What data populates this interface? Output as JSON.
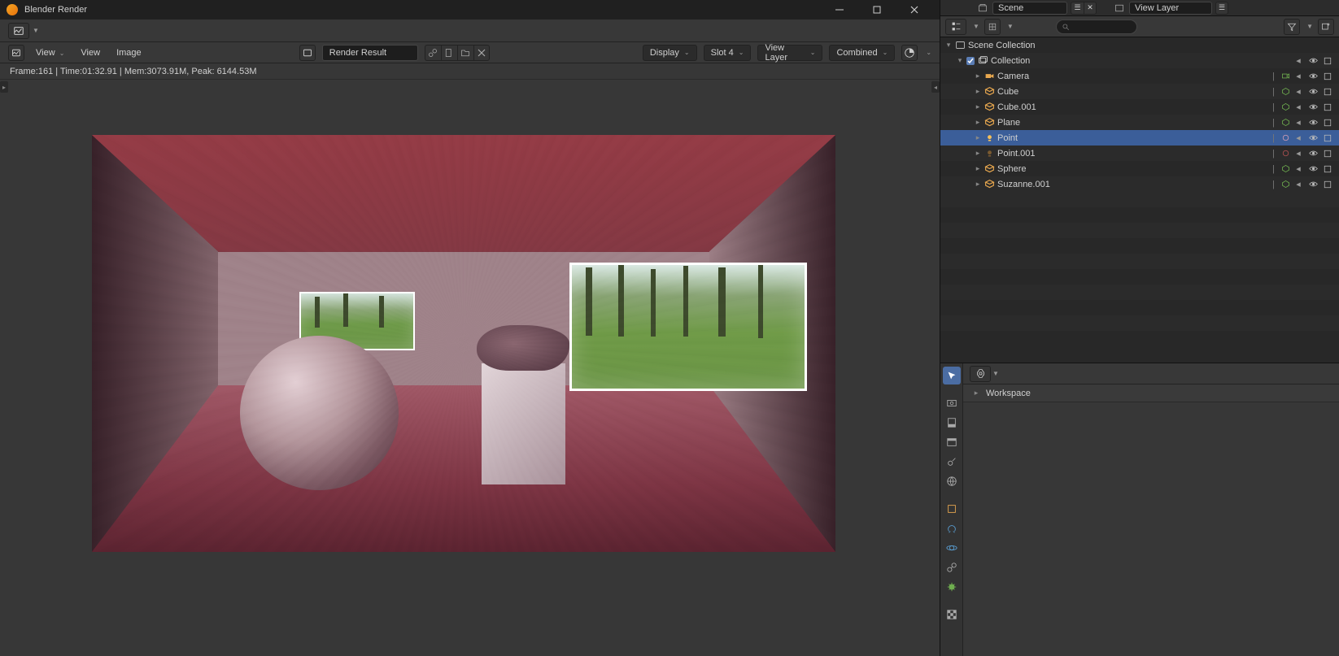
{
  "window": {
    "title": "Blender Render"
  },
  "toolbar": {
    "view_menu": "View",
    "view_menu2": "View",
    "image_menu": "Image",
    "render_result": "Render Result",
    "display_label": "Display",
    "slot_label": "Slot 4",
    "viewlayer_label": "View Layer",
    "pass_label": "Combined"
  },
  "status": {
    "text": "Frame:161 | Time:01:32.91 | Mem:3073.91M, Peak: 6144.53M"
  },
  "scene_bar": {
    "scene": "Scene",
    "viewlayer": "View Layer"
  },
  "outliner": {
    "search_placeholder": "",
    "root": "Scene Collection",
    "collection": "Collection",
    "items": [
      {
        "name": "Camera",
        "type": "camera"
      },
      {
        "name": "Cube",
        "type": "mesh"
      },
      {
        "name": "Cube.001",
        "type": "mesh"
      },
      {
        "name": "Plane",
        "type": "mesh"
      },
      {
        "name": "Point",
        "type": "light",
        "selected": true
      },
      {
        "name": "Point.001",
        "type": "light",
        "muted": true
      },
      {
        "name": "Sphere",
        "type": "mesh"
      },
      {
        "name": "Suzanne.001",
        "type": "mesh"
      }
    ]
  },
  "properties": {
    "panel_title": "Workspace"
  }
}
